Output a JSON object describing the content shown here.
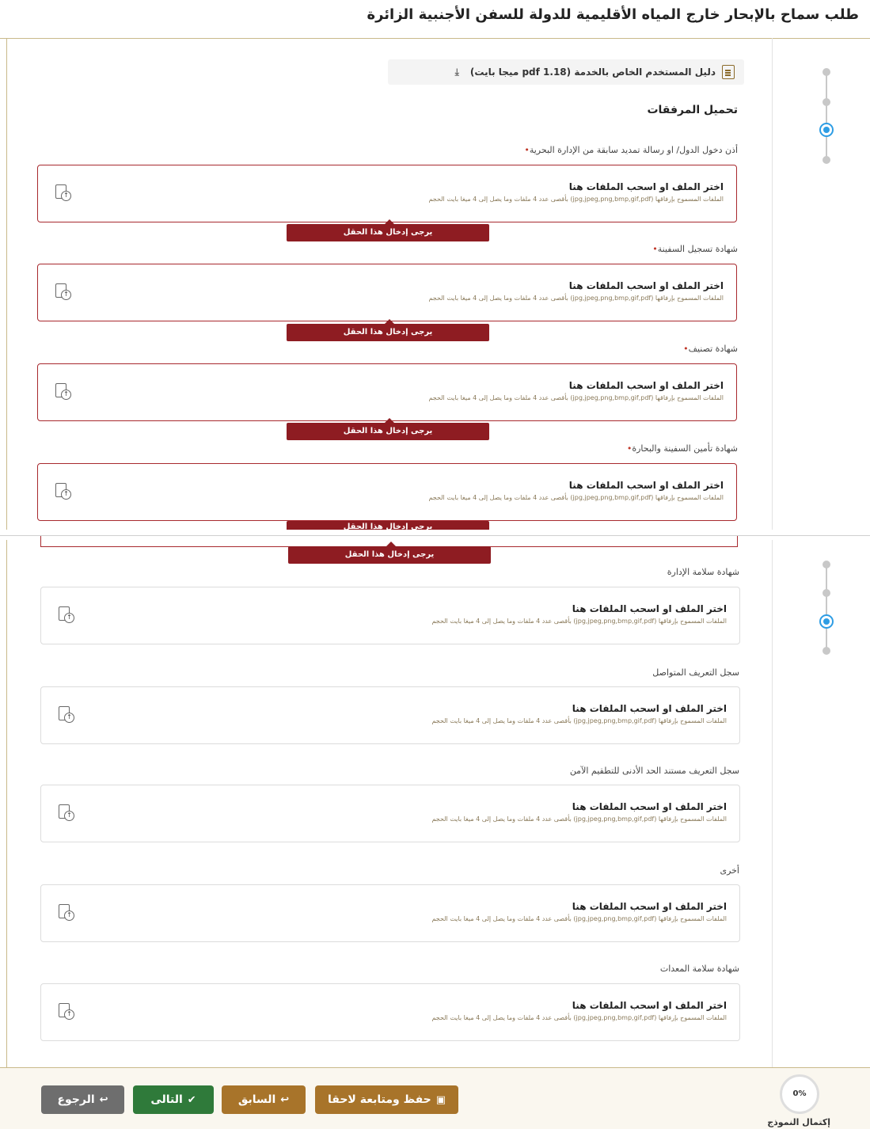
{
  "header": {
    "title": "طلب سماح بالإبحار خارج المياه الأقليمية للدولة للسفن الأجنبية الزائرة"
  },
  "guide": {
    "label": "دليل المستخدم الخاص بالخدمة (pdf 1.18 ميجا بايت)"
  },
  "section_title": "تحميل المرفقات",
  "upload_box": {
    "title": "اختر الملف او اسحب الملفات هنا",
    "subtitle": "الملفات المسموح بإرفاقها (jpg,jpeg,png,bmp,gif,pdf) بأقصى عدد 4 ملفات وما يصل إلى 4 ميغا بايت الحجم"
  },
  "error_text": "يرجى إدخال هذا الحقل",
  "required_marker": "•",
  "fields": [
    {
      "label": "أذن دخول الدول/ او رسالة تمديد سابقة من الإدارة البحرية",
      "required": true
    },
    {
      "label": "شهادة تسجيل السفينة",
      "required": true
    },
    {
      "label": "شهادة تصنيف",
      "required": true
    },
    {
      "label": "شهادة تأمين السفينة والبحارة",
      "required": true
    },
    {
      "label": "شهادة سلامة الإدارة",
      "required": false
    },
    {
      "label": "سجل التعريف المتواصل",
      "required": false
    },
    {
      "label": "سجل التعريف مستند الحد الأدنى للتطقيم الآمن",
      "required": false
    },
    {
      "label": "أخرى",
      "required": false
    },
    {
      "label": "شهادة سلامة المعدات",
      "required": false
    }
  ],
  "footer": {
    "save_label": "حفظ ومتابعة لاحقا",
    "prev_label": "السابق",
    "next_label": "التالى",
    "back_label": "الرجوع",
    "progress_value": "0%",
    "progress_label": "إكتمال النموذج"
  },
  "colors": {
    "error": "#8e1c22",
    "accent": "#a8742a",
    "success": "#2f7a3a",
    "active_step": "#2e9de4"
  },
  "icons": [
    "doc-icon",
    "download-icon",
    "file-upload-icon",
    "save-icon",
    "undo-icon",
    "check-icon"
  ]
}
